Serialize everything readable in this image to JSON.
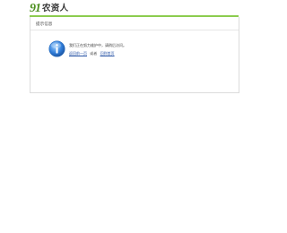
{
  "brand": {
    "logo_mark": "91",
    "name": "农资人"
  },
  "panel": {
    "title": "提示信息",
    "message": "我们正在努力维护中，请稍后访问。",
    "link_back": "返回前一页",
    "or_text": "或者",
    "link_home": "回到首页"
  },
  "colors": {
    "accent_green": "#8ccc4f",
    "info_blue": "#2f7cd8",
    "link_blue": "#2a55a6"
  },
  "icons": {
    "status": "info-icon"
  }
}
